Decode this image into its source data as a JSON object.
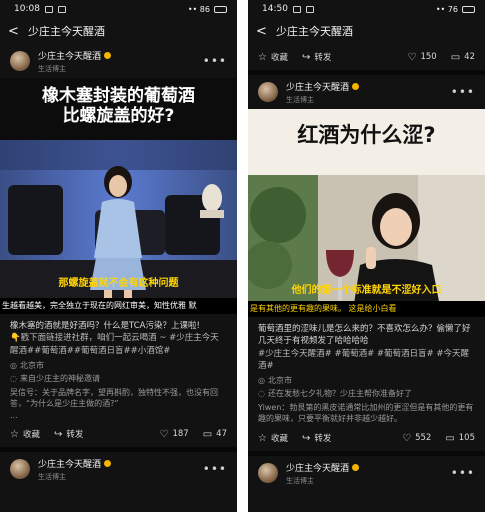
{
  "left": {
    "status": {
      "time": "10:08",
      "right_text": "•• 86"
    },
    "nav": {
      "title": "少庄主今天醒酒"
    },
    "author": {
      "name": "少庄主今天醒酒",
      "subtitle": "生活博主"
    },
    "video": {
      "title_line1": "橡木塞封装的葡萄酒",
      "title_line2": "比螺旋盖的好?",
      "subtitle": "那螺旋盖就不会有这种问题",
      "ticker": "生越看越美，完全独立于现在的网红审美，知性优雅    默"
    },
    "post": {
      "line1": "橡木塞的酒就是好酒吗？什么是TCA污染？上课啦!",
      "line2": "👇戳下面链接进社群，咱们一起云喝酒 ~ #少庄主今天醒酒##葡萄酒##葡萄酒日盲##小酒馆#"
    },
    "location": "北京市",
    "source": "来自少庄主的神秘邀请",
    "comment": "吴信号：关于品牌名字，望再斟酌，独特性不强，也没有回答，“为什么是少庄主做的酒?”",
    "comment_more": "...",
    "actions": {
      "fav": "收藏",
      "share": "转发",
      "likes": "187",
      "comments": "47"
    },
    "author2": {
      "name": "少庄主今天醒酒",
      "subtitle": "生活博主"
    }
  },
  "right": {
    "status": {
      "time": "14:50",
      "right_text": "•• 76"
    },
    "nav": {
      "title": "少庄主今天醒酒"
    },
    "top_actions": {
      "fav": "收藏",
      "share": "转发",
      "likes": "150",
      "comments": "42"
    },
    "author": {
      "name": "少庄主今天醒酒",
      "subtitle": "生活博主"
    },
    "video": {
      "title": "红酒为什么涩?",
      "subtitle": "他们的第一个标准就是不涩好入口",
      "ticker": "是有其他的更有趣的果味。    这是给小白看"
    },
    "post": {
      "line1": "葡萄酒里的涩味儿是怎么来的？不喜欢怎么办？偷懒了好几天终于有视频发了哈哈哈哈",
      "line2": "#少庄主今天醒酒# #葡萄酒# #葡萄酒日盲# #今天醒酒#"
    },
    "location": "北京市",
    "source": "还在发愁七夕礼物？少庄主帮你准备好了",
    "comment": "Yiwen：勃艮第的黑皮诺通常比加州的更涩但是有其他的更有趣的果味，只要平衡就好并非越少越好。",
    "actions": {
      "fav": "收藏",
      "share": "转发",
      "likes": "552",
      "comments": "105"
    },
    "author2": {
      "name": "少庄主今天醒酒",
      "subtitle": "生活博主"
    }
  },
  "colors": {
    "background": "#121212",
    "title_yellow": "#ffd400",
    "verified": "#f5b400"
  }
}
